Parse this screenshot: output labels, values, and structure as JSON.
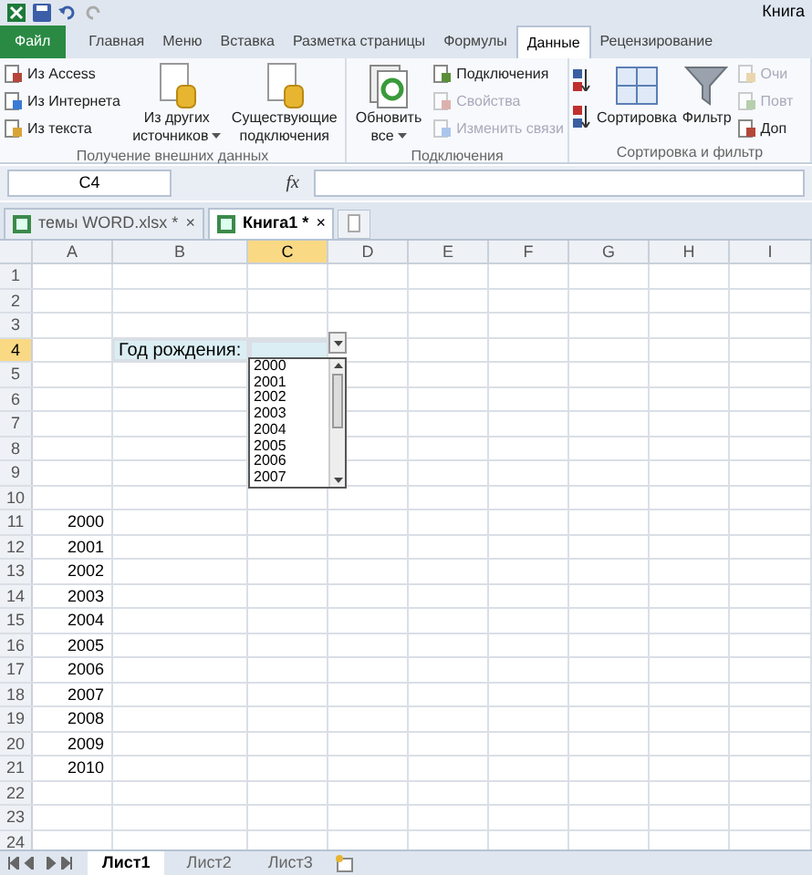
{
  "title_bar": {
    "title": "Книга"
  },
  "ribbon_tabs": [
    {
      "label": "Файл",
      "kind": "file",
      "selected": false
    },
    {
      "label": "Главная",
      "kind": "tab",
      "selected": false
    },
    {
      "label": "Меню",
      "kind": "tab",
      "selected": false
    },
    {
      "label": "Вставка",
      "kind": "tab",
      "selected": false
    },
    {
      "label": "Разметка страницы",
      "kind": "tab",
      "selected": false
    },
    {
      "label": "Формулы",
      "kind": "tab",
      "selected": false
    },
    {
      "label": "Данные",
      "kind": "tab",
      "selected": true
    },
    {
      "label": "Рецензирование",
      "kind": "tab",
      "selected": false
    }
  ],
  "ribbon_groups": [
    {
      "label": "Получение внешних данных",
      "columns": [
        {
          "kind": "small",
          "items": [
            {
              "label": "Из Access",
              "disabled": false
            },
            {
              "label": "Из Интернета",
              "disabled": false
            },
            {
              "label": "Из текста",
              "disabled": false
            }
          ]
        },
        {
          "kind": "large",
          "label": "Из других источников",
          "dropdown": true,
          "disabled": false
        },
        {
          "kind": "large",
          "label": "Существующие подключения",
          "dropdown": false,
          "disabled": false
        }
      ]
    },
    {
      "label": "Подключения",
      "columns": [
        {
          "kind": "large",
          "label": "Обновить все",
          "dropdown": true,
          "disabled": false
        },
        {
          "kind": "small",
          "items": [
            {
              "label": "Подключения",
              "disabled": false
            },
            {
              "label": "Свойства",
              "disabled": true
            },
            {
              "label": "Изменить связи",
              "disabled": true
            }
          ]
        }
      ]
    },
    {
      "label": "Сортировка и фильтр",
      "columns": [
        {
          "kind": "sorticons"
        },
        {
          "kind": "large",
          "label": "Сортировка",
          "dropdown": false,
          "disabled": false
        },
        {
          "kind": "large",
          "label": "Фильтр",
          "dropdown": false,
          "disabled": false
        },
        {
          "kind": "small",
          "items": [
            {
              "label": "Очи",
              "disabled": true
            },
            {
              "label": "Повт",
              "disabled": true
            },
            {
              "label": "Доп",
              "disabled": false
            }
          ]
        }
      ]
    }
  ],
  "formula_bar": {
    "name_box": "C4",
    "fx": "fx"
  },
  "doc_tabs": [
    {
      "label": "темы WORD.xlsx *",
      "selected": false,
      "close": "×"
    },
    {
      "label": "Книга1 *",
      "selected": true,
      "close": "×"
    }
  ],
  "columns": [
    {
      "label": "A",
      "selected": false
    },
    {
      "label": "B",
      "selected": false
    },
    {
      "label": "C",
      "selected": true
    },
    {
      "label": "D",
      "selected": false
    },
    {
      "label": "E",
      "selected": false
    },
    {
      "label": "F",
      "selected": false
    },
    {
      "label": "G",
      "selected": false
    },
    {
      "label": "H",
      "selected": false
    },
    {
      "label": "I",
      "selected": false
    }
  ],
  "rows": [
    {
      "label": "1",
      "selected": false
    },
    {
      "label": "2",
      "selected": false
    },
    {
      "label": "3",
      "selected": false
    },
    {
      "label": "4",
      "selected": true,
      "B": "Год рождения:",
      "C_active": true
    },
    {
      "label": "5",
      "selected": false
    },
    {
      "label": "6",
      "selected": false
    },
    {
      "label": "7",
      "selected": false
    },
    {
      "label": "8",
      "selected": false
    },
    {
      "label": "9",
      "selected": false
    },
    {
      "label": "10",
      "selected": false
    },
    {
      "label": "11",
      "selected": false,
      "A": "2000"
    },
    {
      "label": "12",
      "selected": false,
      "A": "2001"
    },
    {
      "label": "13",
      "selected": false,
      "A": "2002"
    },
    {
      "label": "14",
      "selected": false,
      "A": "2003"
    },
    {
      "label": "15",
      "selected": false,
      "A": "2004"
    },
    {
      "label": "16",
      "selected": false,
      "A": "2005"
    },
    {
      "label": "17",
      "selected": false,
      "A": "2006"
    },
    {
      "label": "18",
      "selected": false,
      "A": "2007"
    },
    {
      "label": "19",
      "selected": false,
      "A": "2008"
    },
    {
      "label": "20",
      "selected": false,
      "A": "2009"
    },
    {
      "label": "21",
      "selected": false,
      "A": "2010"
    },
    {
      "label": "22",
      "selected": false
    },
    {
      "label": "23",
      "selected": false
    },
    {
      "label": "24",
      "selected": false
    }
  ],
  "dropdown_list": {
    "options": [
      "2000",
      "2001",
      "2002",
      "2003",
      "2004",
      "2005",
      "2006",
      "2007"
    ]
  },
  "sheet_tabs": [
    {
      "label": "Лист1",
      "selected": true
    },
    {
      "label": "Лист2",
      "selected": false
    },
    {
      "label": "Лист3",
      "selected": false
    }
  ]
}
